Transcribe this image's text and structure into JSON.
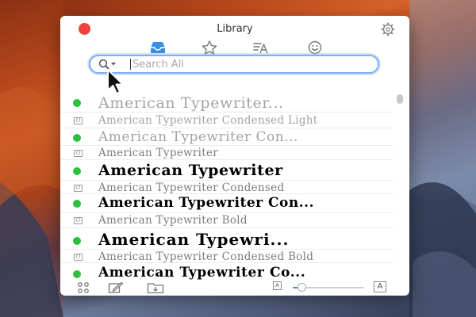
{
  "window": {
    "title": "Library"
  },
  "tabs": [
    {
      "icon": "inbox-icon",
      "active": true
    },
    {
      "icon": "star-icon",
      "active": false
    },
    {
      "icon": "text-translate-icon",
      "active": false
    },
    {
      "icon": "smiley-icon",
      "active": false
    }
  ],
  "search": {
    "placeholder": "Search All",
    "value": ""
  },
  "fonts": [
    {
      "name": "American Typewriter...",
      "activated": true,
      "weight": "regular"
    },
    {
      "name": "American Typewriter Condensed Light",
      "activated": false,
      "weight": "light"
    },
    {
      "name": "American Typewriter Con...",
      "activated": true,
      "weight": "light"
    },
    {
      "name": "American Typewriter",
      "activated": false,
      "weight": "gray"
    },
    {
      "name": "American Typewriter",
      "activated": true,
      "weight": "semibold"
    },
    {
      "name": "American Typewriter Condensed",
      "activated": false,
      "weight": "gray"
    },
    {
      "name": "American Typewriter Con...",
      "activated": true,
      "weight": "semibold"
    },
    {
      "name": "American Typewriter Bold",
      "activated": false,
      "weight": "gray"
    },
    {
      "name": "American Typewri...",
      "activated": true,
      "weight": "bold"
    },
    {
      "name": "American Typewriter Condensed Bold",
      "activated": false,
      "weight": "gray"
    },
    {
      "name": "American Typewriter Co...",
      "activated": true,
      "weight": "bold"
    }
  ],
  "toolbar": {
    "icons": [
      "grid-icon",
      "edit-icon",
      "folder-download-icon"
    ],
    "size_small_label": "A",
    "size_large_label": "A",
    "preview_size_fraction": 0.12
  },
  "colors": {
    "accent": "#4a90e2",
    "activated": "#29c23b",
    "close": "#f0413b"
  }
}
